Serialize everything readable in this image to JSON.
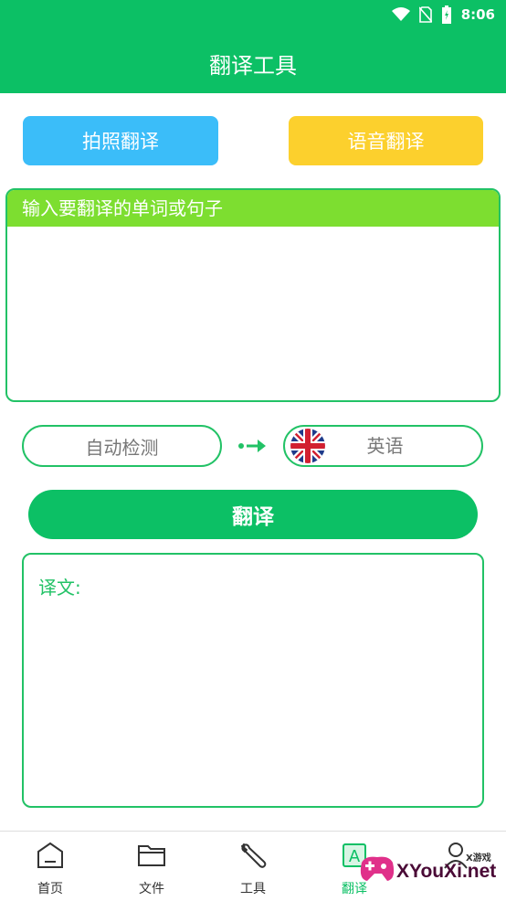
{
  "status": {
    "time": "8:06"
  },
  "header": {
    "title": "翻译工具"
  },
  "actions": {
    "photo_translate": "拍照翻译",
    "voice_translate": "语音翻译"
  },
  "input": {
    "label": "输入要翻译的单词或句子"
  },
  "languages": {
    "source": "自动检测",
    "target": "英语"
  },
  "translate_button": "翻译",
  "result": {
    "label": "译文:"
  },
  "nav": {
    "items": [
      {
        "label": "首页",
        "icon": "home-icon"
      },
      {
        "label": "文件",
        "icon": "folder-icon"
      },
      {
        "label": "工具",
        "icon": "wrench-icon"
      },
      {
        "label": "翻译",
        "icon": "translate-icon"
      },
      {
        "label": "",
        "icon": "profile-icon"
      }
    ]
  },
  "watermark": {
    "brand": "XYouXi.net",
    "sub": "X游戏"
  },
  "colors": {
    "primary": "#0cc065",
    "photo": "#3bbdf9",
    "voice": "#fcd02d",
    "input_header": "#7dde30"
  }
}
